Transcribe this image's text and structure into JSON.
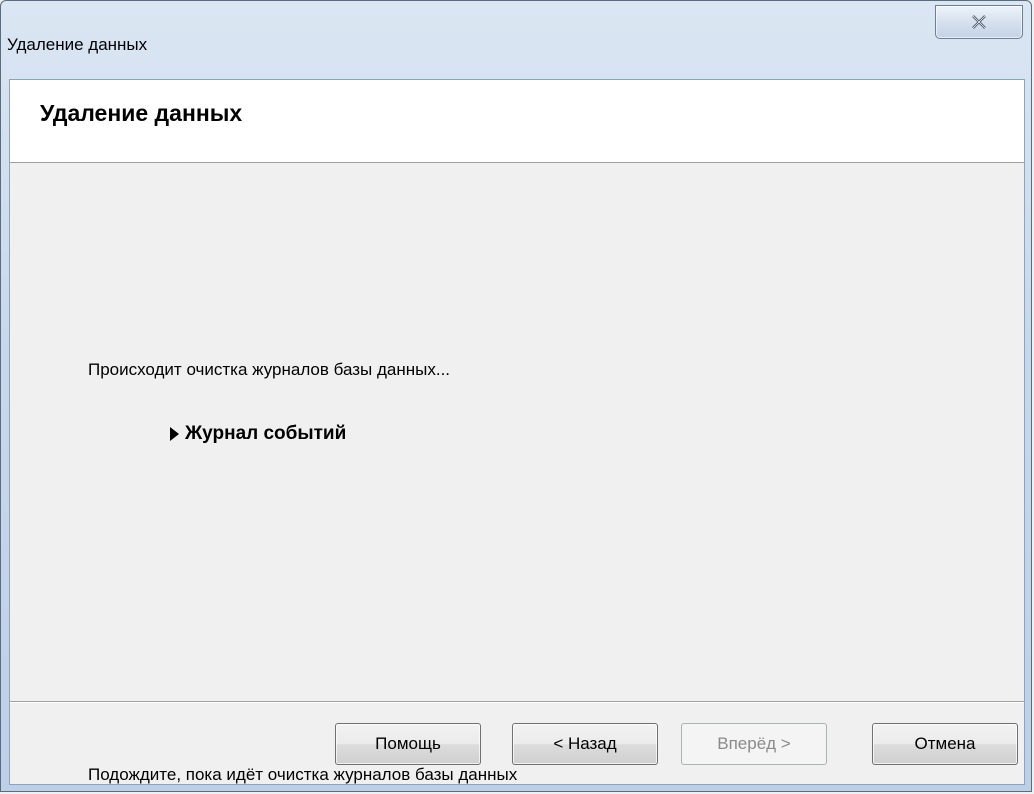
{
  "window": {
    "title": "Удаление данных"
  },
  "header": {
    "title": "Удаление данных"
  },
  "body": {
    "status_text": "Происходит очистка журналов базы данных...",
    "current_step": "Журнал событий",
    "bottom_text": "Подождите, пока идёт очистка журналов базы данных"
  },
  "buttons": {
    "help": "Помощь",
    "back": "< Назад",
    "next": "Вперёд >",
    "cancel": "Отмена"
  },
  "icons": {
    "close": "close-icon",
    "step": "step-arrow-icon"
  }
}
